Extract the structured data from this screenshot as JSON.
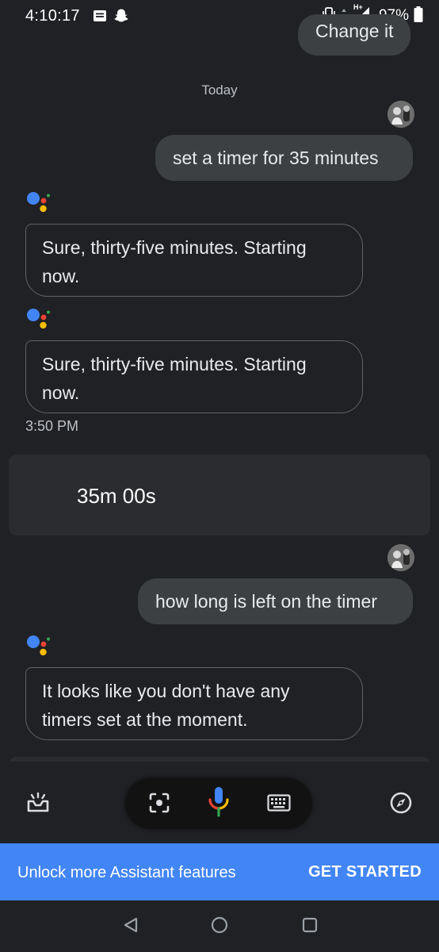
{
  "status_bar": {
    "time": "4:10:17",
    "network": "H+",
    "battery": "97%"
  },
  "chat": {
    "previous_chip": "Change it",
    "date_separator": "Today",
    "messages": [
      {
        "role": "user",
        "text": "set a timer for 35 minutes"
      },
      {
        "role": "assistant",
        "lines": [
          "Sure, thirty-five minutes. Starting",
          "now."
        ]
      },
      {
        "role": "assistant",
        "lines": [
          "Sure, thirty-five minutes. Starting",
          "now."
        ]
      },
      {
        "role": "user",
        "text": "how long is left on the timer"
      },
      {
        "role": "assistant",
        "lines": [
          "It looks like you don't have any",
          "timers set at the moment."
        ]
      }
    ],
    "timestamp": "3:50 PM",
    "timer_card": {
      "value": "35m 00s"
    }
  },
  "banner": {
    "text": "Unlock more Assistant features",
    "cta": "GET STARTED"
  },
  "colors": {
    "google_blue": "#4285f4",
    "google_red": "#ea4335",
    "google_yellow": "#fbbc05",
    "google_green": "#34a853",
    "background": "#202124"
  },
  "icons": {
    "input_bar": [
      "snapshot-icon",
      "lens-icon",
      "mic-icon",
      "keyboard-icon",
      "compass-icon"
    ],
    "nav_bar": [
      "back-icon",
      "home-icon",
      "recents-icon"
    ]
  }
}
